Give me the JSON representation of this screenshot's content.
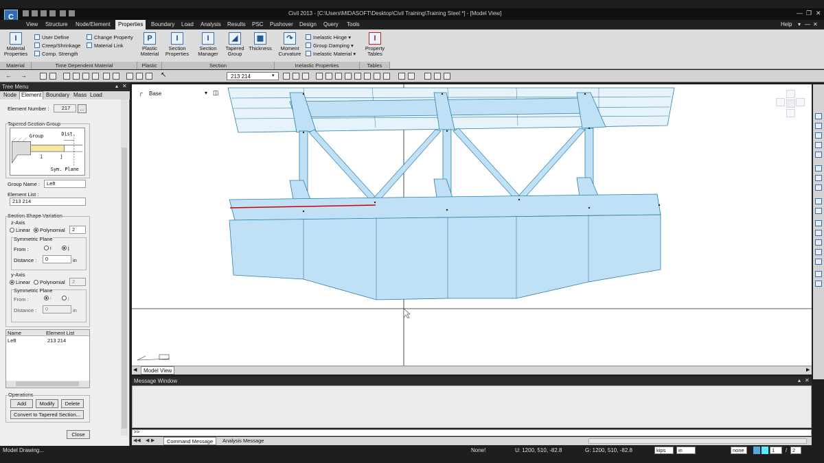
{
  "window": {
    "title": "Civil 2013 - [C:\\Users\\MIDASOFT\\Desktop\\Civil Training\\Training Steel *] - [Model View]"
  },
  "menu": {
    "items": [
      "View",
      "Structure",
      "Node/Element",
      "Properties",
      "Boundary",
      "Load",
      "Analysis",
      "Results",
      "PSC",
      "Pushover",
      "Design",
      "Query",
      "Tools"
    ],
    "active": "Properties",
    "help": "Help"
  },
  "ribbon": {
    "material_properties": "Material Properties",
    "user_define": "User Define",
    "creep_shrinkage": "Creep/Shrinkage",
    "comp_strength": "Comp. Strength",
    "change_property": "Change Property",
    "material_link": "Material Link",
    "plastic_material": "Plastic Material",
    "section_properties": "Section Properties",
    "section_manager": "Section Manager",
    "tapered_group": "Tapered Group",
    "thickness": "Thickness",
    "moment_curvature": "Moment Curvature",
    "inelastic_hinge": "Inelastic Hinge",
    "group_damping": "Group Damping",
    "inelastic_material": "Inelastic Material",
    "property_tables": "Property Tables",
    "groups": {
      "material": "Material",
      "time_dependent": "Time Dependent Material",
      "plastic": "Plastic",
      "section": "Section",
      "inelastic": "Inelastic Properties",
      "tables": "Tables"
    }
  },
  "toolbar": {
    "element_selection": "213 214"
  },
  "tree": {
    "title": "Tree Menu",
    "tabs": [
      "Node",
      "Element",
      "Boundary",
      "Mass",
      "Load"
    ],
    "active_tab": "Element",
    "element_number_label": "Element Number :",
    "element_number": "217",
    "tapered_group_title": "Tapered Section Group",
    "diagram": {
      "group": "Group",
      "dist": "Dist.",
      "i": "i",
      "j": "j",
      "sym_plane": "Sym. Plane"
    },
    "group_name_label": "Group Name :",
    "group_name": "Left",
    "element_list_label": "Element List :",
    "element_list": "213 214",
    "section_shape_title": "Section Shape Variation",
    "z_axis": {
      "title": "z-Axis",
      "linear": "Linear",
      "polynomial": "Polynomial",
      "order": "2",
      "sym_title": "Symmetric Plane",
      "from_label": "From :",
      "i": "i",
      "j": "j",
      "distance_label": "Distance :",
      "distance": "0",
      "unit": "in"
    },
    "y_axis": {
      "title": "y-Axis",
      "linear": "Linear",
      "polynomial": "Polynomial",
      "order": "2",
      "sym_title": "Symmetric Plane",
      "from_label": "From :",
      "i": "i",
      "j": "j",
      "distance_label": "Distance :",
      "distance": "0",
      "unit": "in"
    },
    "table": {
      "headers": [
        "Name",
        "Element List"
      ],
      "rows": [
        [
          "Left",
          "213 214"
        ]
      ]
    },
    "operations": {
      "title": "Operations",
      "add": "Add",
      "modify": "Modify",
      "delete": "Delete",
      "convert": "Convert to Tapered Section...",
      "close": "Close"
    }
  },
  "viewport": {
    "base_label": "Base",
    "tab_label": "Model View"
  },
  "message": {
    "title": "Message Window",
    "prompt": ">>",
    "tabs": [
      "Command Message",
      "Analysis Message"
    ]
  },
  "status": {
    "left": "Model Drawing...",
    "none": "None!",
    "u_coord": "U: 1200, 510, -82.8",
    "g_coord": "G: 1200, 510, -82.8",
    "force_unit": "kips",
    "length_unit": "in",
    "mode": "none",
    "page_current": "1",
    "page_total": "2"
  },
  "colors": {
    "model_fill": "#bfe0f5",
    "model_stroke": "#2a7fa8",
    "selected_element": "#cc0000",
    "ribbon_bg": "#dcdcdc"
  }
}
